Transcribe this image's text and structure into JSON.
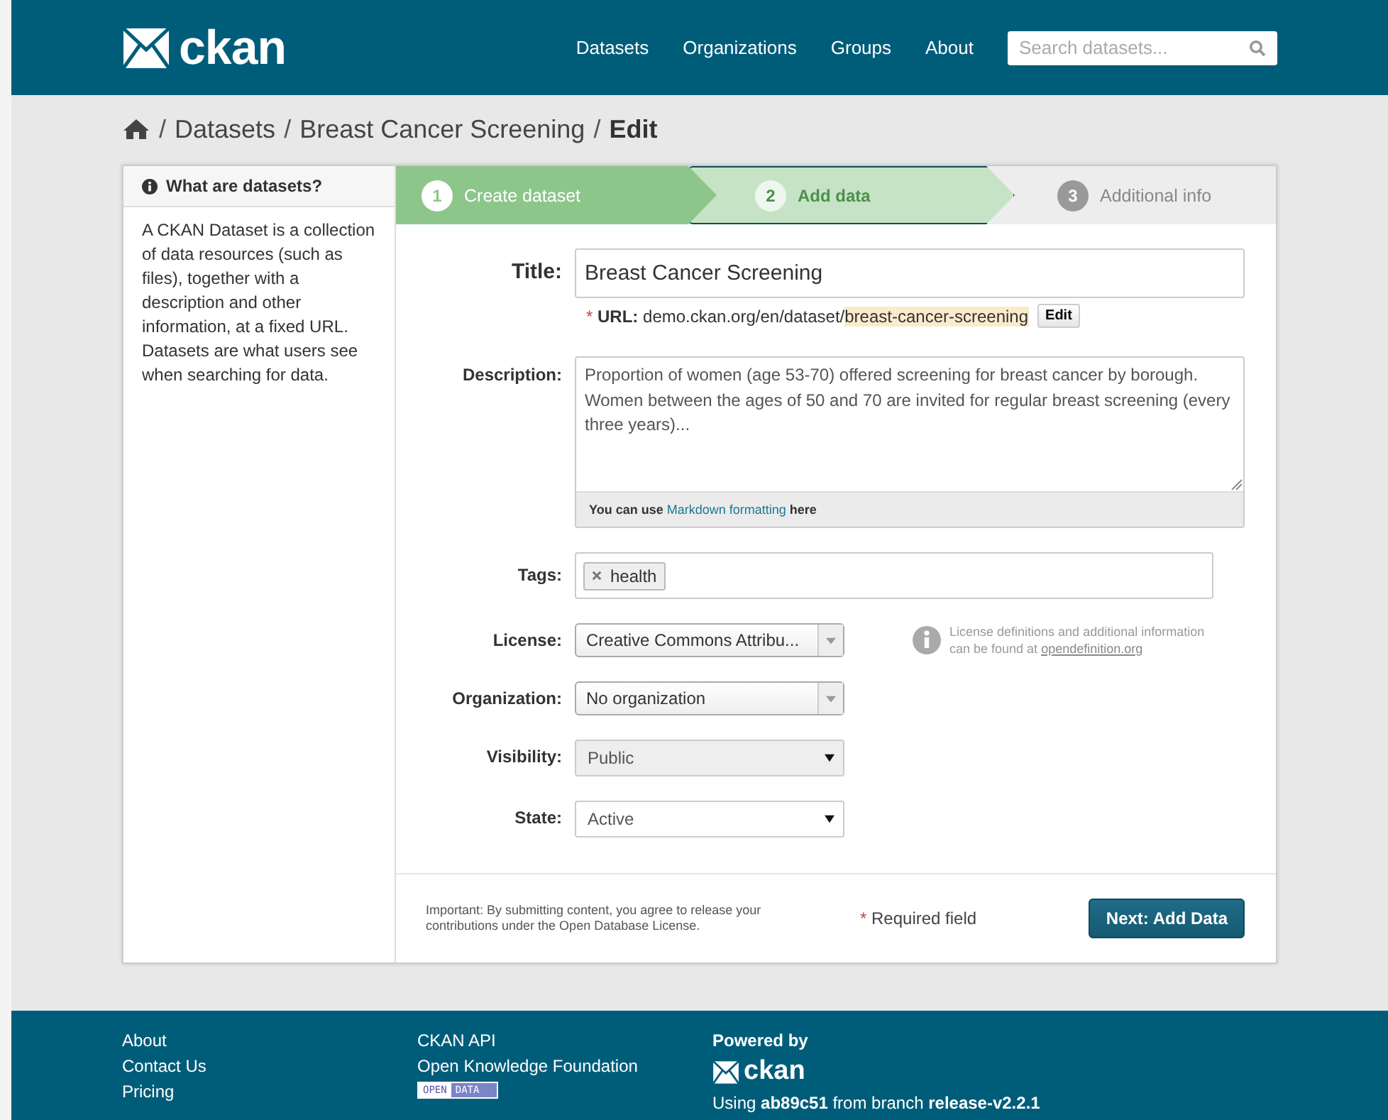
{
  "header": {
    "logo": "ckan",
    "nav": [
      "Datasets",
      "Organizations",
      "Groups",
      "About"
    ],
    "search": {
      "placeholder": "Search datasets..."
    }
  },
  "breadcrumb": {
    "separator": "/",
    "items": [
      {
        "label": "Datasets",
        "current": false
      },
      {
        "label": "Breast Cancer Screening",
        "current": false
      },
      {
        "label": "Edit",
        "current": true
      }
    ]
  },
  "sidebar": {
    "title": "What are datasets?",
    "text": "A CKAN Dataset is a collection of data resources (such as files), together with a description and other information, at a fixed URL. Datasets are what users see when searching for data."
  },
  "stages": [
    {
      "number": "1",
      "label": "Create dataset",
      "kind": "active"
    },
    {
      "number": "2",
      "label": "Add data",
      "kind": "upcoming"
    },
    {
      "number": "3",
      "label": "Additional info",
      "kind": "pending"
    }
  ],
  "form": {
    "fields": [
      {
        "kind": "title",
        "label": "Title:",
        "value": "Breast Cancer Screening",
        "url": {
          "required_mark": "*",
          "label": "URL:",
          "prefix": "demo.ckan.org/en/dataset/",
          "slug": "breast-cancer-screening",
          "button": "Edit"
        }
      },
      {
        "kind": "textarea",
        "label": "Description:",
        "value": "Proportion of women (age 53-70) offered screening for breast cancer by borough. Women between the ages of 50 and 70 are invited for regular breast screening (every three years)...",
        "hint": {
          "before": "You can use",
          "link": "Markdown formatting",
          "after": "here"
        }
      },
      {
        "kind": "tags",
        "label": "Tags:",
        "tags": [
          "health"
        ]
      },
      {
        "kind": "combo",
        "label": "License:",
        "value": "Creative Commons Attribu...",
        "note": {
          "text": "License definitions and additional information can be found at",
          "link": "opendefinition.org"
        }
      },
      {
        "kind": "combo",
        "label": "Organization:",
        "value": "No organization"
      },
      {
        "kind": "select",
        "label": "Visibility:",
        "value": "Public",
        "disabled": true
      },
      {
        "kind": "select",
        "label": "State:",
        "value": "Active",
        "disabled": false
      }
    ],
    "notice": "Important: By submitting content, you agree to release your contributions under the Open Database License.",
    "required": {
      "mark": "*",
      "text": "Required field"
    },
    "submit": "Next: Add Data"
  },
  "footer": {
    "links": [
      "About",
      "Contact Us",
      "Pricing"
    ],
    "links2": [
      "CKAN API",
      "Open Knowledge Foundation"
    ],
    "badge": [
      "OPEN",
      "DATA"
    ],
    "powered_by": "Powered by",
    "logo": "ckan",
    "version": "Using **ab89c51** from branch **release-v2.2.1**"
  }
}
